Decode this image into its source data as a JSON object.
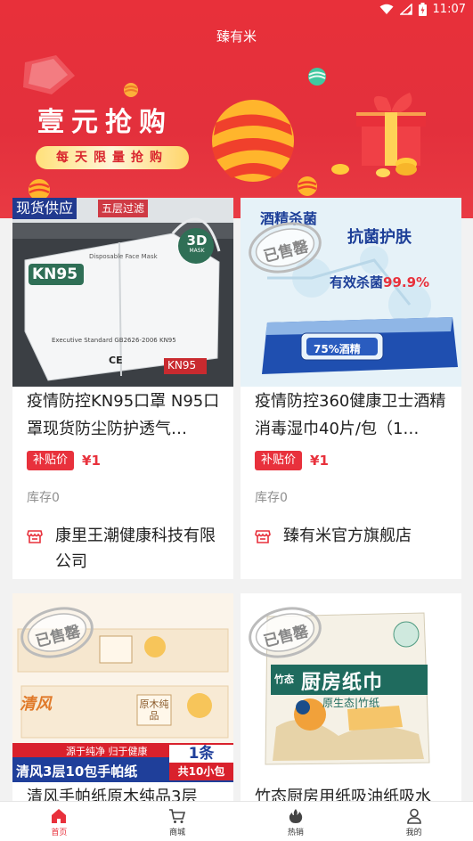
{
  "status_bar": {
    "time": "11:07"
  },
  "app": {
    "title": "臻有米"
  },
  "banner": {
    "title": "壹元抢购",
    "subtitle": "每天限量抢购"
  },
  "products": [
    {
      "title": "疫情防控KN95口罩 N95口罩现货防尘防护透气…",
      "subsidy_label": "补贴价",
      "price": "¥1",
      "stock": "库存0",
      "shop": "康里王潮健康科技有限公司",
      "image_text": {
        "tag_main": "现货供应",
        "tag_sub": "五层过滤",
        "brand": "KN95",
        "mask_3d": "3D",
        "mask_3d_sub": "MASK",
        "line1": "Disposable Face Mask",
        "line2": "Executive Standard  GB2626-2006 KN95",
        "ce": "CE",
        "kn95_small": "KN95"
      }
    },
    {
      "title": "疫情防控360健康卫士酒精消毒湿巾40片/包（1…",
      "subsidy_label": "补贴价",
      "price": "¥1",
      "stock": "库存0",
      "shop": "臻有米官方旗舰店",
      "image_text": {
        "tag1": "酒精杀菌",
        "tag2": "抗菌护肤",
        "tag3_pre": "有效杀菌",
        "tag3_pct": "99.9%",
        "pack": "75%酒精",
        "stamp": "已售罄"
      }
    },
    {
      "title": "清风手帕纸原木纯品3层",
      "image_text": {
        "stamp": "已售罄",
        "brand": "清风",
        "pack": "原木纯品",
        "slogan": "源于纯净 归于健康",
        "name": "清风3层10包手帕纸",
        "qty_big": "1条",
        "qty_small": "共10小包"
      }
    },
    {
      "title": "竹态厨房用纸吸油纸吸水",
      "image_text": {
        "stamp": "已售罄",
        "brand": "竹态",
        "name": "厨房纸巾",
        "sub": "原生态|竹纸"
      }
    }
  ],
  "tabbar": {
    "tabs": [
      {
        "label": "首页",
        "icon": "home-icon",
        "active": true
      },
      {
        "label": "商城",
        "icon": "cart-icon",
        "active": false
      },
      {
        "label": "热销",
        "icon": "fire-icon",
        "active": false
      },
      {
        "label": "我的",
        "icon": "user-icon",
        "active": false
      }
    ]
  },
  "colors": {
    "brand_red": "#e8313c",
    "banner_red": "#e3303c"
  }
}
